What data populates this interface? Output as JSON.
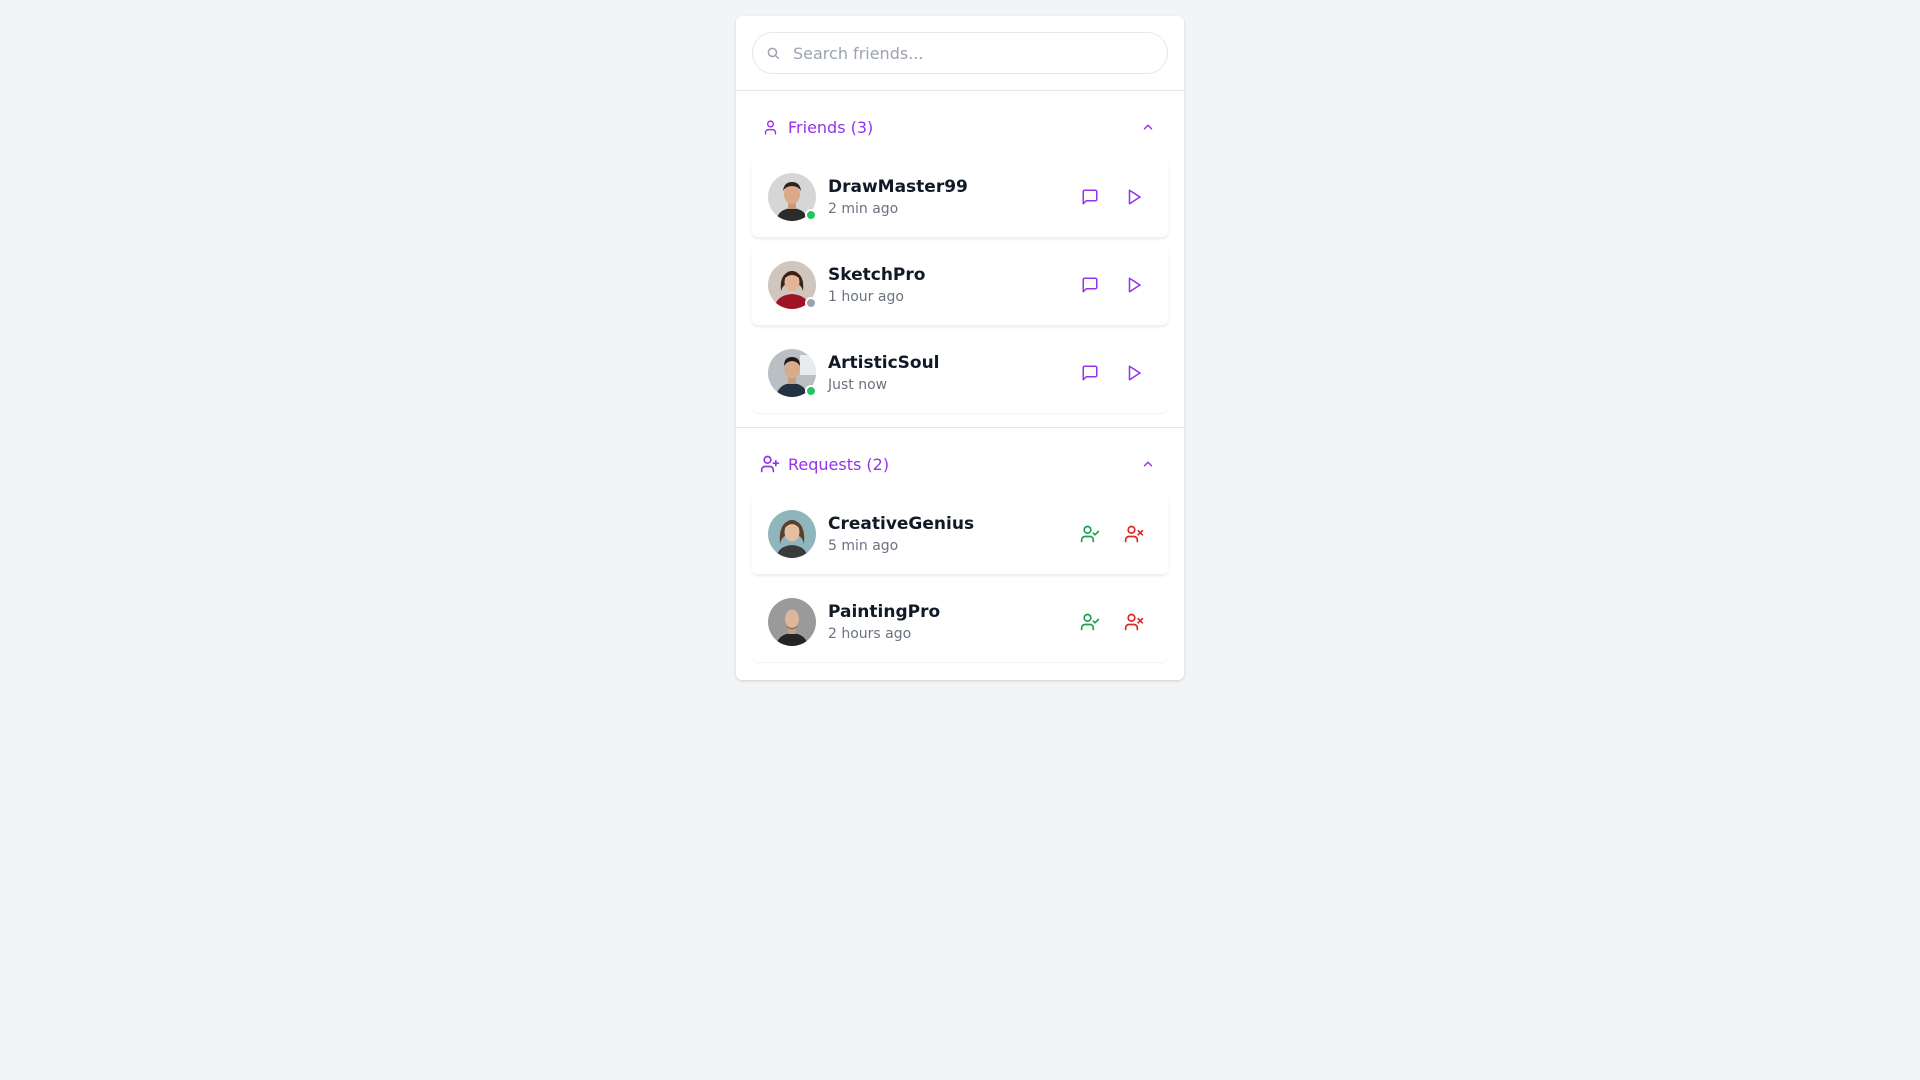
{
  "search": {
    "placeholder": "Search friends..."
  },
  "friends": {
    "title": "Friends (3)",
    "items": [
      {
        "name": "DrawMaster99",
        "time": "2 min ago",
        "status": "online"
      },
      {
        "name": "SketchPro",
        "time": "1 hour ago",
        "status": "offline"
      },
      {
        "name": "ArtisticSoul",
        "time": "Just now",
        "status": "online"
      }
    ]
  },
  "requests": {
    "title": "Requests (2)",
    "items": [
      {
        "name": "CreativeGenius",
        "time": "5 min ago"
      },
      {
        "name": "PaintingPro",
        "time": "2 hours ago"
      }
    ]
  },
  "colors": {
    "accent": "#9333ea",
    "online": "#22c55e",
    "offline": "#9ca3af",
    "accept": "#16a34a",
    "decline": "#dc2626"
  },
  "icons": {
    "search": "search-icon",
    "friends": "user-icon",
    "requests": "user-plus-icon",
    "collapse": "chevron-up-icon",
    "message": "message-square-icon",
    "play": "play-icon",
    "accept": "user-check-icon",
    "decline": "user-x-icon"
  }
}
